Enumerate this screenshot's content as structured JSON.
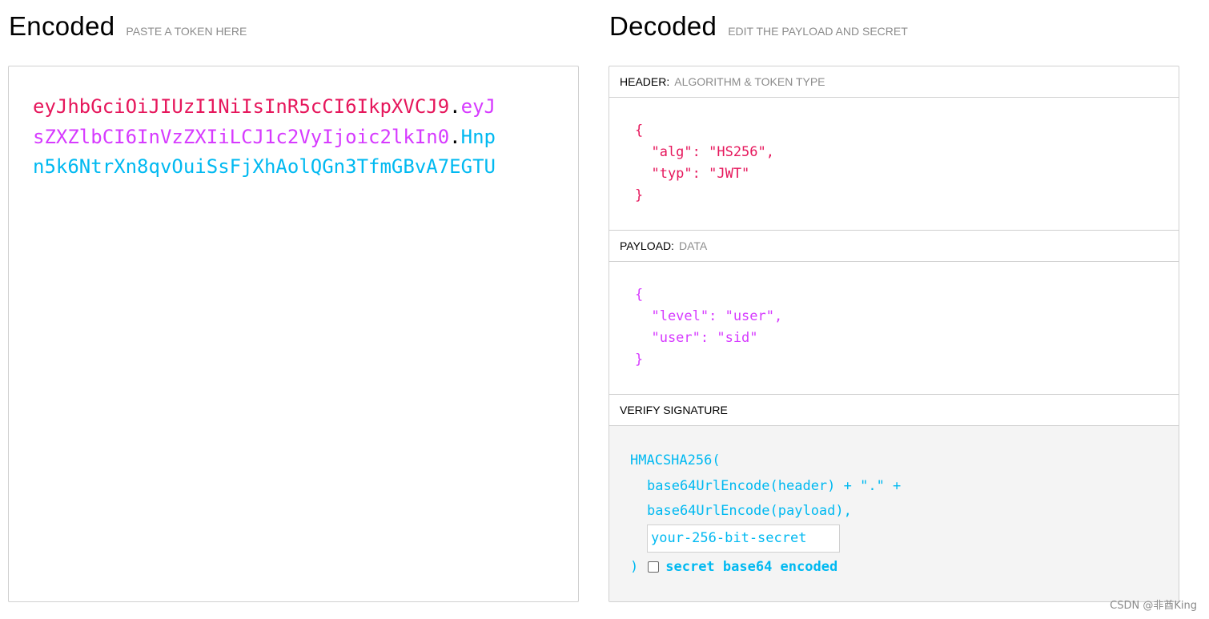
{
  "encoded": {
    "title": "Encoded",
    "subtitle": "PASTE A TOKEN HERE",
    "token_header": "eyJhbGciOiJIUzI1NiIsInR5cCI6IkpXVCJ9",
    "token_payload": "eyJsZXZlbCI6InVzZXIiLCJ1c2VyIjoic2lkIn0",
    "token_signature": "Hnpn5k6NtrXn8qvOuiSsFjXhAolQGn3TfmGBvA7EGTU",
    "dot": "."
  },
  "decoded": {
    "title": "Decoded",
    "subtitle": "EDIT THE PAYLOAD AND SECRET",
    "header": {
      "label": "HEADER:",
      "desc": "ALGORITHM & TOKEN TYPE",
      "lines": [
        "{",
        "  \"alg\": \"HS256\",",
        "  \"typ\": \"JWT\"",
        "}"
      ]
    },
    "payload": {
      "label": "PAYLOAD:",
      "desc": "DATA",
      "lines": [
        "{",
        "  \"level\": \"user\",",
        "  \"user\": \"sid\"",
        "}"
      ]
    },
    "verify": {
      "label": "VERIFY SIGNATURE",
      "fn": "HMACSHA256(",
      "line_header": "base64UrlEncode(header) + \".\" +",
      "line_payload": "base64UrlEncode(payload),",
      "secret_placeholder": "your-256-bit-secret",
      "close": ")",
      "b64_label": "secret base64 encoded"
    }
  },
  "watermark": "CSDN @非酋King",
  "colors": {
    "header": "#e6175c",
    "payload": "#d63aff",
    "signature": "#00b9f1"
  }
}
